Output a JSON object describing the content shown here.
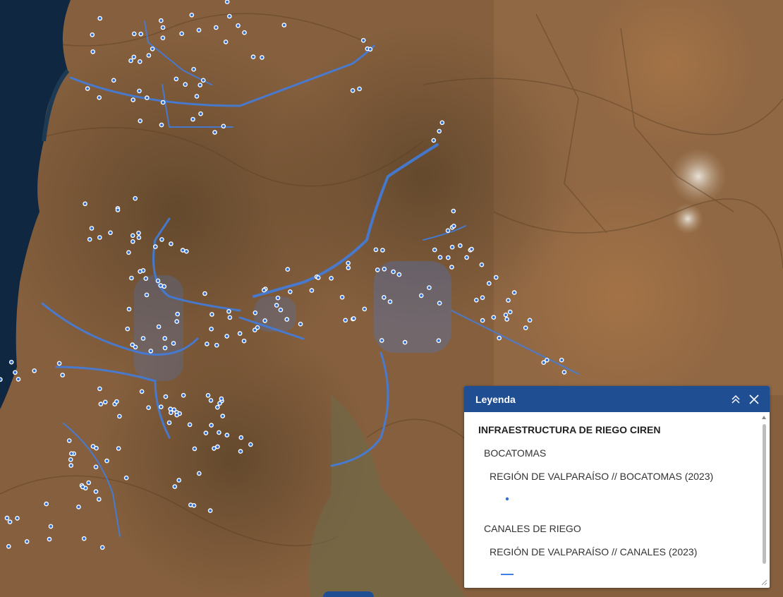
{
  "legend": {
    "title": "Leyenda",
    "layer_title": "INFRAESTRUCTURA DE RIEGO CIREN",
    "groups": [
      {
        "label": "BOCATOMAS",
        "sublayer": "REGIÓN DE VALPARAÍSO // BOCATOMAS (2023)",
        "symbol": "point-dot"
      },
      {
        "label": "CANALES DE RIEGO",
        "sublayer": "REGIÓN DE VALPARAÍSO // CANALES (2023)",
        "symbol": "line"
      }
    ],
    "collapse_icon": "double-chevron-up-icon",
    "close_icon": "close-icon"
  },
  "colors": {
    "header": "#1f4e93",
    "canal": "#3f7fe6",
    "bocatoma": "#2f6fd8",
    "ocean": "#0f2740",
    "terrain": "#8a5e3b"
  }
}
